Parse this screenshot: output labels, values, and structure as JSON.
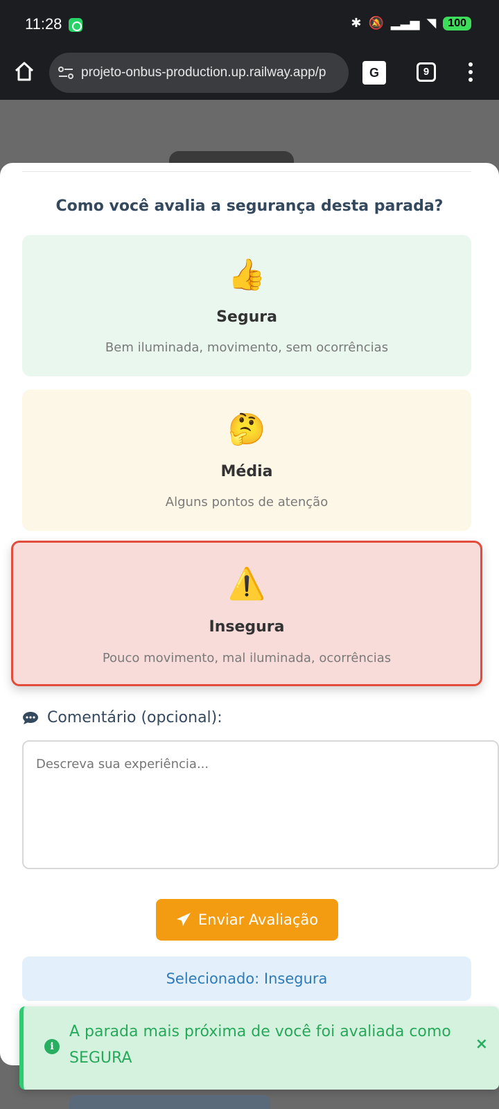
{
  "status_bar": {
    "time": "11:28",
    "icons": [
      "whatsapp-icon",
      "bluetooth-icon",
      "mute-icon",
      "signal-icon",
      "wifi-icon"
    ],
    "battery": "100"
  },
  "browser": {
    "url": "projeto-onbus-production.up.railway.app/p",
    "tabs_count": "9",
    "translate_label": "G"
  },
  "modal": {
    "question": "Como você avalia a segurança desta parada?",
    "options": [
      {
        "emoji": "👍",
        "title": "Segura",
        "description": "Bem iluminada, movimento, sem ocorrências",
        "color": "#e9f7ee"
      },
      {
        "emoji": "🤔",
        "title": "Média",
        "description": "Alguns pontos de atenção",
        "color": "#fdf7e7"
      },
      {
        "emoji": "⚠️",
        "title": "Insegura",
        "description": "Pouco movimento, mal iluminada, ocorrências",
        "color": "#f8dcd9",
        "selected": true
      }
    ],
    "comment_label": "Comentário (opcional):",
    "comment_placeholder": "Descreva sua experiência...",
    "comment_value": "",
    "submit_label": "Enviar Avaliação",
    "selected_text": "Selecionado: Insegura"
  },
  "toast": {
    "message": "A parada mais próxima de você foi avaliada como SEGURA",
    "icon": "info-icon",
    "close": "×"
  },
  "colors": {
    "accent": "#f39c12",
    "danger": "#e34c3b",
    "success": "#27ae60",
    "info": "#2f7bb8"
  }
}
